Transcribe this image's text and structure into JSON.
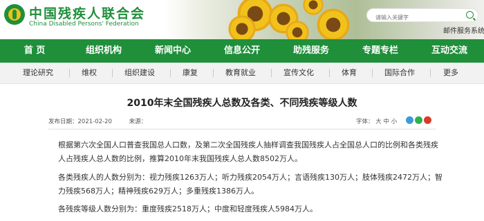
{
  "header": {
    "logo_cn": "中国残疾人联合会",
    "logo_en": "China Disabled Persons' Federation",
    "search_placeholder": "请输入关键字",
    "mail_link": "邮件服务系统",
    "colors": {
      "brand_green": "#1f8f3a",
      "accent_yellow": "#f3c018"
    }
  },
  "nav": {
    "items": [
      "首 页",
      "组织机构",
      "新闻中心",
      "信息公开",
      "助残服务",
      "专题专栏",
      "互动交流"
    ]
  },
  "subnav": {
    "items": [
      "理论研究",
      "维权",
      "组织建设",
      "康复",
      "教育就业",
      "宣传文化",
      "体育",
      "国际合作",
      "更多"
    ]
  },
  "article": {
    "title": "2010年末全国残疾人总数及各类、不同残疾等级人数",
    "date_label": "发布日期：",
    "date": "2021-02-20",
    "source_label": "来源：",
    "font_size_label": "字体：",
    "font_size_options": [
      "大",
      "中",
      "小"
    ],
    "paragraphs": [
      "根据第六次全国人口普查我国总人口数，及第二次全国残疾人抽样调查我国残疾人占全国总人口的比例和各类残疾人占残疾人总人数的比例，推算2010年末我国残疾人总人数8502万人。",
      "各类残疾人的人数分别为：视力残疾1263万人；听力残疾2054万人；言语残疾130万人；肢体残疾2472万人；智力残疾568万人；精神残疾629万人；多重残疾1386万人。",
      "各残疾等级人数分别为：重度残疾2518万人；中度和轻度残疾人5984万人。"
    ]
  }
}
